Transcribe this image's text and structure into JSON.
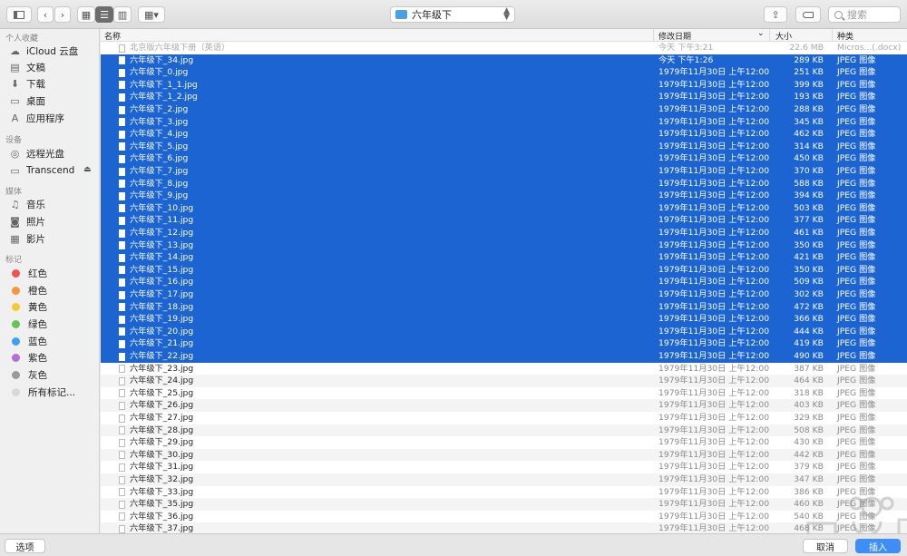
{
  "toolbar": {
    "folder_name": "六年级下",
    "search_placeholder": "搜索"
  },
  "sidebar": {
    "favorites_header": "个人收藏",
    "favorites": [
      {
        "label": "iCloud 云盘",
        "icon": "cloud-icon"
      },
      {
        "label": "文稿",
        "icon": "documents-icon"
      },
      {
        "label": "下载",
        "icon": "downloads-icon"
      },
      {
        "label": "桌面",
        "icon": "desktop-icon"
      },
      {
        "label": "应用程序",
        "icon": "applications-icon"
      }
    ],
    "devices_header": "设备",
    "devices": [
      {
        "label": "远程光盘",
        "icon": "disc-icon"
      },
      {
        "label": "Transcend",
        "icon": "drive-icon"
      }
    ],
    "media_header": "媒体",
    "media": [
      {
        "label": "音乐",
        "icon": "music-icon"
      },
      {
        "label": "照片",
        "icon": "camera-icon"
      },
      {
        "label": "影片",
        "icon": "film-icon"
      }
    ],
    "tags_header": "标记",
    "tags": [
      {
        "label": "红色",
        "color": "#f0524f"
      },
      {
        "label": "橙色",
        "color": "#f5963a"
      },
      {
        "label": "黄色",
        "color": "#f4c931"
      },
      {
        "label": "绿色",
        "color": "#62c554"
      },
      {
        "label": "蓝色",
        "color": "#3ba1f4"
      },
      {
        "label": "紫色",
        "color": "#b46fd8"
      },
      {
        "label": "灰色",
        "color": "#9a9a9a"
      },
      {
        "label": "所有标记...",
        "color": "#d8d8d8"
      }
    ]
  },
  "columns": {
    "name": "名称",
    "date": "修改日期",
    "size": "大小",
    "kind": "种类"
  },
  "files": [
    {
      "name": "北京版六年级下册（英语）",
      "date": "今天 下午3:21",
      "size": "22.6 MB",
      "kind": "Micros...(.docx)",
      "state": "dim"
    },
    {
      "name": "六年级下_34.jpg",
      "date": "今天 下午1:26",
      "size": "289 KB",
      "kind": "JPEG 图像",
      "state": "sel"
    },
    {
      "name": "六年级下_0.jpg",
      "date": "1979年11月30日 上午12:00",
      "size": "251 KB",
      "kind": "JPEG 图像",
      "state": "sel"
    },
    {
      "name": "六年级下_1_1.jpg",
      "date": "1979年11月30日 上午12:00",
      "size": "399 KB",
      "kind": "JPEG 图像",
      "state": "sel"
    },
    {
      "name": "六年级下_1_2.jpg",
      "date": "1979年11月30日 上午12:00",
      "size": "193 KB",
      "kind": "JPEG 图像",
      "state": "sel"
    },
    {
      "name": "六年级下_2.jpg",
      "date": "1979年11月30日 上午12:00",
      "size": "288 KB",
      "kind": "JPEG 图像",
      "state": "sel"
    },
    {
      "name": "六年级下_3.jpg",
      "date": "1979年11月30日 上午12:00",
      "size": "345 KB",
      "kind": "JPEG 图像",
      "state": "sel"
    },
    {
      "name": "六年级下_4.jpg",
      "date": "1979年11月30日 上午12:00",
      "size": "462 KB",
      "kind": "JPEG 图像",
      "state": "sel"
    },
    {
      "name": "六年级下_5.jpg",
      "date": "1979年11月30日 上午12:00",
      "size": "314 KB",
      "kind": "JPEG 图像",
      "state": "sel"
    },
    {
      "name": "六年级下_6.jpg",
      "date": "1979年11月30日 上午12:00",
      "size": "450 KB",
      "kind": "JPEG 图像",
      "state": "sel"
    },
    {
      "name": "六年级下_7.jpg",
      "date": "1979年11月30日 上午12:00",
      "size": "370 KB",
      "kind": "JPEG 图像",
      "state": "sel"
    },
    {
      "name": "六年级下_8.jpg",
      "date": "1979年11月30日 上午12:00",
      "size": "588 KB",
      "kind": "JPEG 图像",
      "state": "sel"
    },
    {
      "name": "六年级下_9.jpg",
      "date": "1979年11月30日 上午12:00",
      "size": "394 KB",
      "kind": "JPEG 图像",
      "state": "sel"
    },
    {
      "name": "六年级下_10.jpg",
      "date": "1979年11月30日 上午12:00",
      "size": "503 KB",
      "kind": "JPEG 图像",
      "state": "sel"
    },
    {
      "name": "六年级下_11.jpg",
      "date": "1979年11月30日 上午12:00",
      "size": "377 KB",
      "kind": "JPEG 图像",
      "state": "sel"
    },
    {
      "name": "六年级下_12.jpg",
      "date": "1979年11月30日 上午12:00",
      "size": "461 KB",
      "kind": "JPEG 图像",
      "state": "sel"
    },
    {
      "name": "六年级下_13.jpg",
      "date": "1979年11月30日 上午12:00",
      "size": "350 KB",
      "kind": "JPEG 图像",
      "state": "sel"
    },
    {
      "name": "六年级下_14.jpg",
      "date": "1979年11月30日 上午12:00",
      "size": "421 KB",
      "kind": "JPEG 图像",
      "state": "sel"
    },
    {
      "name": "六年级下_15.jpg",
      "date": "1979年11月30日 上午12:00",
      "size": "350 KB",
      "kind": "JPEG 图像",
      "state": "sel"
    },
    {
      "name": "六年级下_16.jpg",
      "date": "1979年11月30日 上午12:00",
      "size": "509 KB",
      "kind": "JPEG 图像",
      "state": "sel"
    },
    {
      "name": "六年级下_17.jpg",
      "date": "1979年11月30日 上午12:00",
      "size": "302 KB",
      "kind": "JPEG 图像",
      "state": "sel"
    },
    {
      "name": "六年级下_18.jpg",
      "date": "1979年11月30日 上午12:00",
      "size": "472 KB",
      "kind": "JPEG 图像",
      "state": "sel"
    },
    {
      "name": "六年级下_19.jpg",
      "date": "1979年11月30日 上午12:00",
      "size": "366 KB",
      "kind": "JPEG 图像",
      "state": "sel"
    },
    {
      "name": "六年级下_20.jpg",
      "date": "1979年11月30日 上午12:00",
      "size": "444 KB",
      "kind": "JPEG 图像",
      "state": "sel"
    },
    {
      "name": "六年级下_21.jpg",
      "date": "1979年11月30日 上午12:00",
      "size": "419 KB",
      "kind": "JPEG 图像",
      "state": "sel"
    },
    {
      "name": "六年级下_22.jpg",
      "date": "1979年11月30日 上午12:00",
      "size": "490 KB",
      "kind": "JPEG 图像",
      "state": "sel"
    },
    {
      "name": "六年级下_23.jpg",
      "date": "1979年11月30日 上午12:00",
      "size": "387 KB",
      "kind": "JPEG 图像",
      "state": "unsel"
    },
    {
      "name": "六年级下_24.jpg",
      "date": "1979年11月30日 上午12:00",
      "size": "464 KB",
      "kind": "JPEG 图像",
      "state": "unsel"
    },
    {
      "name": "六年级下_25.jpg",
      "date": "1979年11月30日 上午12:00",
      "size": "318 KB",
      "kind": "JPEG 图像",
      "state": "unsel"
    },
    {
      "name": "六年级下_26.jpg",
      "date": "1979年11月30日 上午12:00",
      "size": "403 KB",
      "kind": "JPEG 图像",
      "state": "unsel"
    },
    {
      "name": "六年级下_27.jpg",
      "date": "1979年11月30日 上午12:00",
      "size": "329 KB",
      "kind": "JPEG 图像",
      "state": "unsel"
    },
    {
      "name": "六年级下_28.jpg",
      "date": "1979年11月30日 上午12:00",
      "size": "508 KB",
      "kind": "JPEG 图像",
      "state": "unsel"
    },
    {
      "name": "六年级下_29.jpg",
      "date": "1979年11月30日 上午12:00",
      "size": "430 KB",
      "kind": "JPEG 图像",
      "state": "unsel"
    },
    {
      "name": "六年级下_30.jpg",
      "date": "1979年11月30日 上午12:00",
      "size": "442 KB",
      "kind": "JPEG 图像",
      "state": "unsel"
    },
    {
      "name": "六年级下_31.jpg",
      "date": "1979年11月30日 上午12:00",
      "size": "379 KB",
      "kind": "JPEG 图像",
      "state": "unsel"
    },
    {
      "name": "六年级下_32.jpg",
      "date": "1979年11月30日 上午12:00",
      "size": "347 KB",
      "kind": "JPEG 图像",
      "state": "unsel"
    },
    {
      "name": "六年级下_33.jpg",
      "date": "1979年11月30日 上午12:00",
      "size": "386 KB",
      "kind": "JPEG 图像",
      "state": "unsel"
    },
    {
      "name": "六年级下_35.jpg",
      "date": "1979年11月30日 上午12:00",
      "size": "460 KB",
      "kind": "JPEG 图像",
      "state": "unsel"
    },
    {
      "name": "六年级下_36.jpg",
      "date": "1979年11月30日 上午12:00",
      "size": "540 KB",
      "kind": "JPEG 图像",
      "state": "unsel"
    },
    {
      "name": "六年级下_37.jpg",
      "date": "1979年11月30日 上午12:00",
      "size": "468 KB",
      "kind": "JPEG 图像",
      "state": "unsel"
    }
  ],
  "bottom": {
    "options_label": "选项",
    "cancel_label": "取消",
    "insert_label": "插入"
  },
  "colors": {
    "selection": "#1c64d2",
    "accent": "#3d8ef7"
  }
}
